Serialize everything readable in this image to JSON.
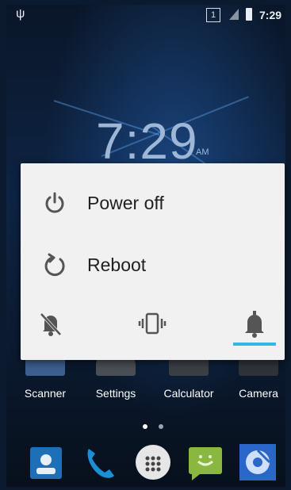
{
  "status_bar": {
    "sim_slot": "1",
    "time": "7:29",
    "icons": [
      "usb-icon",
      "sim-icon",
      "no-signal-icon",
      "battery-charging-icon"
    ]
  },
  "lockclock": {
    "time": "7:29",
    "ampm": "AM"
  },
  "apps": [
    {
      "label": "Scanner",
      "icon": "scanner-icon"
    },
    {
      "label": "Settings",
      "icon": "settings-icon"
    },
    {
      "label": "Calculator",
      "icon": "calculator-icon"
    },
    {
      "label": "Camera",
      "icon": "camera-icon"
    }
  ],
  "dock": [
    {
      "icon": "contacts-icon"
    },
    {
      "icon": "phone-icon"
    },
    {
      "icon": "app-drawer-icon"
    },
    {
      "icon": "messaging-icon"
    },
    {
      "icon": "browser-icon"
    }
  ],
  "power_dialog": {
    "options": [
      {
        "label": "Power off",
        "icon": "power-icon"
      },
      {
        "label": "Reboot",
        "icon": "reboot-icon"
      }
    ],
    "sound_modes": [
      {
        "icon": "silent-icon",
        "selected": false
      },
      {
        "icon": "vibrate-icon",
        "selected": false
      },
      {
        "icon": "sound-on-icon",
        "selected": true
      }
    ],
    "accent_color": "#33b5e5"
  }
}
